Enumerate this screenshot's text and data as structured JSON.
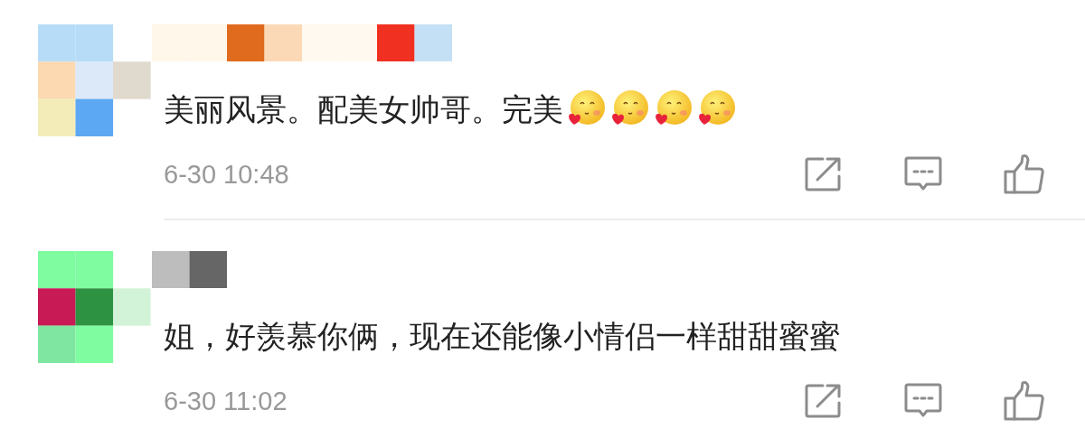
{
  "comments": [
    {
      "text": "美丽风景。配美女帅哥。完美",
      "emojis": [
        {
          "kind": "blush-heart"
        },
        {
          "kind": "blush-heart"
        },
        {
          "kind": "blush-heart"
        },
        {
          "kind": "blush-heart"
        }
      ],
      "time": "6-30 10:48"
    },
    {
      "text": "姐，好羡慕你俩，现在还能像小情侣一样甜甜蜜蜜",
      "time": "6-30 11:02"
    }
  ]
}
